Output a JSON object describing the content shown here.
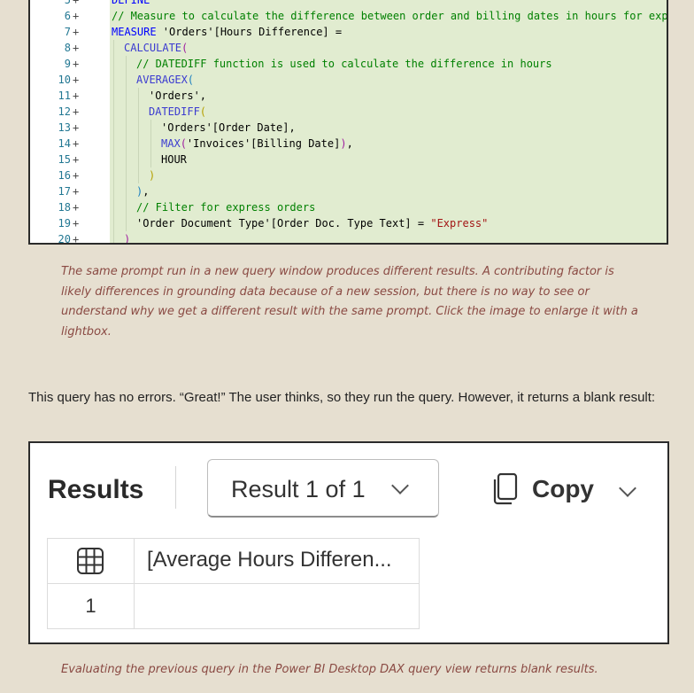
{
  "code_editor": {
    "lines": [
      {
        "num": "5",
        "segs": [
          {
            "t": "DEFINE",
            "c": "k-kw"
          }
        ]
      },
      {
        "num": "6",
        "segs": [
          {
            "t": "// Measure to calculate the difference between order and billing dates in hours for express",
            "c": "k-comment"
          }
        ]
      },
      {
        "num": "7",
        "segs": [
          {
            "t": "MEASURE",
            "c": "k-kw"
          },
          {
            "t": " 'Orders'",
            "c": "k-txt"
          },
          {
            "t": "[Hours Difference]",
            "c": "k-txt"
          },
          {
            "t": " =",
            "c": "k-txt"
          }
        ]
      },
      {
        "num": "8",
        "segs": [
          {
            "t": "CALCULATE",
            "c": "k-fn"
          },
          {
            "t": "(",
            "c": "k-paren2"
          }
        ]
      },
      {
        "num": "9",
        "segs": [
          {
            "t": "// DATEDIFF function is used to calculate the difference in hours",
            "c": "k-comment"
          }
        ]
      },
      {
        "num": "10",
        "segs": [
          {
            "t": "AVERAGEX",
            "c": "k-fn"
          },
          {
            "t": "(",
            "c": "k-paren3"
          }
        ]
      },
      {
        "num": "11",
        "segs": [
          {
            "t": "'Orders',",
            "c": "k-txt"
          }
        ]
      },
      {
        "num": "12",
        "segs": [
          {
            "t": "DATEDIFF",
            "c": "k-fn"
          },
          {
            "t": "(",
            "c": "k-paren"
          }
        ]
      },
      {
        "num": "13",
        "segs": [
          {
            "t": "'Orders'",
            "c": "k-txt"
          },
          {
            "t": "[Order Date]",
            "c": "k-txt"
          },
          {
            "t": ",",
            "c": "k-txt"
          }
        ]
      },
      {
        "num": "14",
        "segs": [
          {
            "t": "MAX",
            "c": "k-fn"
          },
          {
            "t": "(",
            "c": "k-paren2"
          },
          {
            "t": "'Invoices'",
            "c": "k-txt"
          },
          {
            "t": "[Billing Date]",
            "c": "k-txt"
          },
          {
            "t": ")",
            "c": "k-paren2"
          },
          {
            "t": ",",
            "c": "k-txt"
          }
        ]
      },
      {
        "num": "15",
        "segs": [
          {
            "t": "HOUR",
            "c": "k-txt"
          }
        ]
      },
      {
        "num": "16",
        "segs": [
          {
            "t": ")",
            "c": "k-paren"
          }
        ]
      },
      {
        "num": "17",
        "segs": [
          {
            "t": ")",
            "c": "k-paren3"
          },
          {
            "t": ",",
            "c": "k-txt"
          }
        ]
      },
      {
        "num": "18",
        "segs": [
          {
            "t": "// Filter for express orders",
            "c": "k-comment"
          }
        ]
      },
      {
        "num": "19",
        "segs": [
          {
            "t": "'Order Document Type'",
            "c": "k-txt"
          },
          {
            "t": "[Order Doc. Type Text]",
            "c": "k-txt"
          },
          {
            "t": " = ",
            "c": "k-txt"
          },
          {
            "t": "\"Express\"",
            "c": "k-str"
          }
        ]
      },
      {
        "num": "20",
        "segs": [
          {
            "t": ")",
            "c": "k-paren2"
          }
        ]
      }
    ]
  },
  "caption_1": "The same prompt run in a new query window produces different results. A contributing factor is likely differences in grounding data because of a new session, but there is no way to see or understand why we get a different result with the same prompt. Click the image to enlarge it with a lightbox.",
  "body_text": "This query has no errors. “Great!” The user thinks, so they run the query. However, it returns a blank result:",
  "results": {
    "title": "Results",
    "selector_label": "Result 1 of 1",
    "copy_label": "Copy",
    "column_header": "[Average Hours Differen...",
    "rows": [
      {
        "index": "1",
        "value": ""
      }
    ]
  },
  "caption_2": "Evaluating the previous query in the Power BI Desktop DAX query view returns blank results."
}
